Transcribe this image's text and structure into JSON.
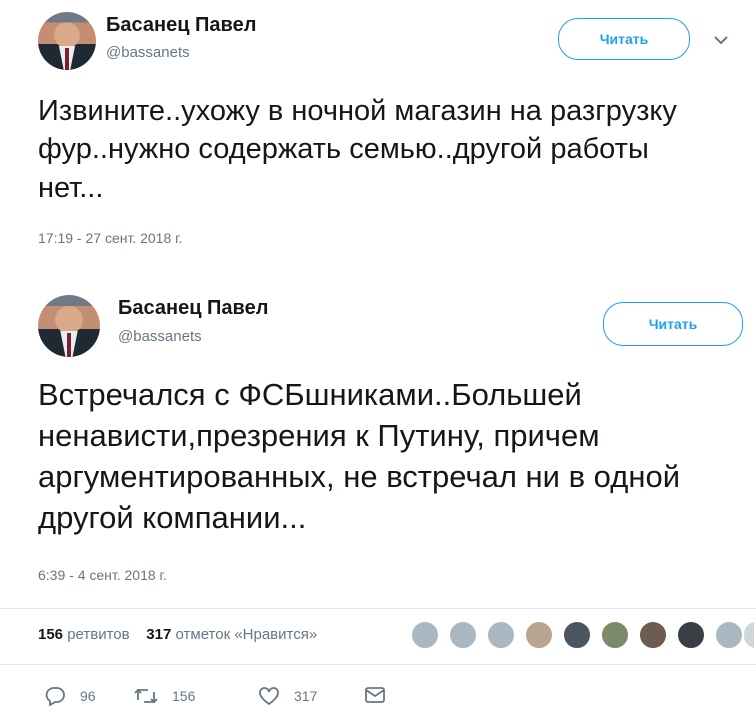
{
  "tweet1": {
    "author_name": "Басанец Павел",
    "author_handle": "@bassanets",
    "follow_label": "Читать",
    "text": "Извините..ухожу в ночной магазин на разгрузку фур..нужно содержать семью..другой работы нет...",
    "timestamp": "17:19 - 27 сент. 2018 г."
  },
  "tweet2": {
    "author_name": "Басанец Павел",
    "author_handle": "@bassanets",
    "follow_label": "Читать",
    "text": "Встречался с ФСБшниками..Большей ненависти,презрения к Путину, причем аргументированных, не встречал ни в одной другой компании...",
    "timestamp": "6:39 - 4 сент. 2018 г.",
    "stats": {
      "retweets_count": "156",
      "retweets_label": "ретвитов",
      "likes_count": "317",
      "likes_label": "отметок «Нравится»"
    },
    "actions": {
      "reply_count": "96",
      "retweet_count": "156",
      "like_count": "317"
    }
  },
  "colors": {
    "accent": "#1da1f2",
    "secondary_text": "#657786",
    "primary_text": "#14171a",
    "divider": "#e1e8ed"
  },
  "icons": [
    "chevron-down-icon",
    "reply-icon",
    "retweet-icon",
    "heart-icon",
    "message-icon"
  ]
}
